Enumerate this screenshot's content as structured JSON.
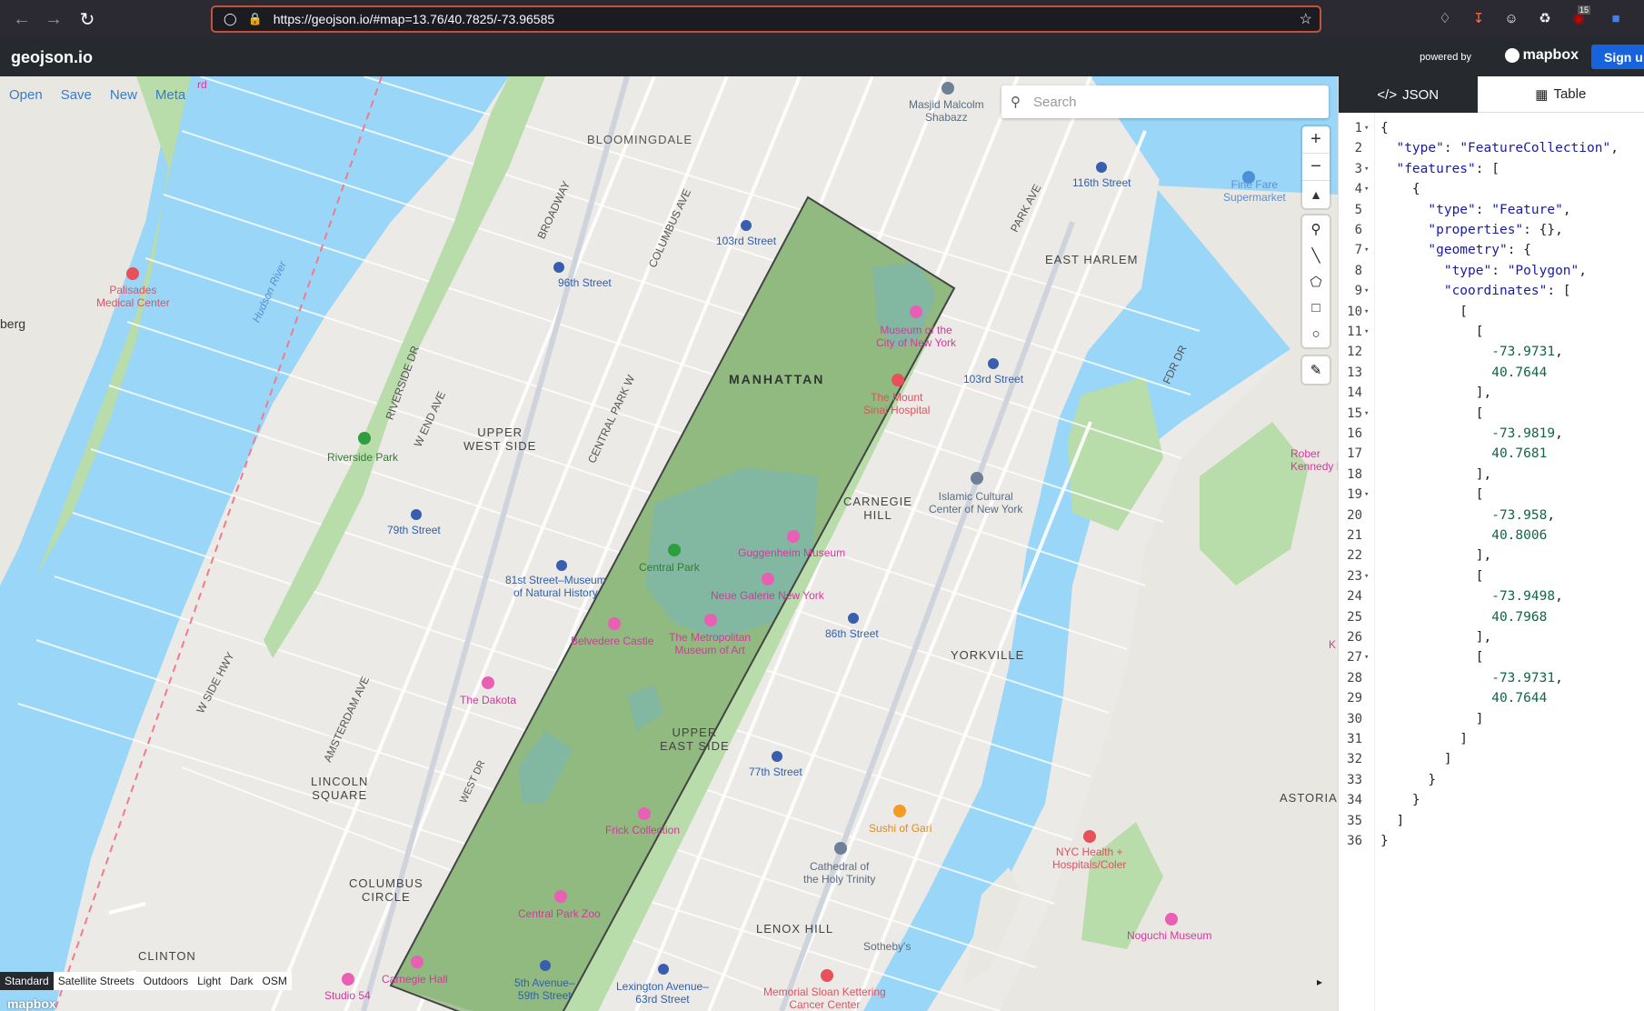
{
  "browser": {
    "url": "https://geojson.io/#map=13.76/40.7825/-73.96585",
    "badge_count": "15"
  },
  "header": {
    "logo": "geojson.io",
    "powered_by": "powered by",
    "mapbox": "mapbox",
    "signup": "Sign u"
  },
  "file_menu": {
    "open": "Open",
    "save": "Save",
    "new": "New",
    "meta": "Meta"
  },
  "search": {
    "placeholder": "Search"
  },
  "layers": {
    "standard": "Standard",
    "satellite": "Satellite Streets",
    "outdoors": "Outdoors",
    "light": "Light",
    "dark": "Dark",
    "osm": "OSM"
  },
  "map_watermark": "mapbox",
  "map_labels": {
    "bloomingdale": "BLOOMINGDALE",
    "manhattan": "MANHATTAN",
    "upper_west_side": "UPPER\nWEST SIDE",
    "east_harlem": "EAST HARLEM",
    "carnegie_hill": "CARNEGIE\nHILL",
    "yorkville": "YORKVILLE",
    "upper_east_side": "UPPER\nEAST SIDE",
    "lenox_hill": "LENOX HILL",
    "lincoln_square": "LINCOLN\nSQUARE",
    "columbus_circle": "COLUMBUS\nCIRCLE",
    "clinton": "CLINTON",
    "astoria": "ASTORIA",
    "central_park": "Central Park",
    "riverside_park": "Riverside Park",
    "palisades": "Palisades\nMedical Center",
    "museum_city": "Museum of the\nCity of New York",
    "mount_sinai": "The Mount\nSinai Hospital",
    "guggenheim": "Guggenheim Museum",
    "neue_galerie": "Neue Galerie New York",
    "met": "The Metropolitan\nMuseum of Art",
    "belvedere": "Belvedere Castle",
    "dakota": "The Dakota",
    "natural_history": "81st Street–Museum\nof Natural History",
    "frick": "Frick Collection",
    "zoo": "Central Park Zoo",
    "carnegie_hall": "Carnegie Hall",
    "studio54": "Studio 54",
    "islamic": "Islamic Cultural\nCenter of New York",
    "cathedral": "Cathedral of\nthe Holy Trinity",
    "sushi": "Sushi of Gari",
    "nyc_health": "NYC Health +\nHospitals/Coler",
    "noguchi": "Noguchi Museum",
    "sothebys": "Sotheby's",
    "memorial": "Memorial Sloan Kettering\nCancer Center",
    "fine_fare": "Fine Fare\nSupermarket",
    "masjid": "Masjid Malcolm\nShabazz",
    "st_103_w": "103rd Street",
    "st_96": "96th Street",
    "st_79": "79th Street",
    "st_116": "116th Street",
    "st_103_e": "103rd Street",
    "st_86": "86th Street",
    "st_77": "77th Street",
    "st_5th": "5th Avenue–\n59th Street",
    "st_lex": "Lexington Avenue–\n63rd Street",
    "hudson": "Hudson River",
    "broadway": "BROADWAY",
    "columbus_ave": "COLUMBUS AVE",
    "central_park_w": "CENTRAL PARK W",
    "amsterdam": "AMSTERDAM AVE",
    "w_end": "W END AVE",
    "riverside_dr": "RIVERSIDE DR",
    "park_ave": "PARK AVE",
    "fdr": "FDR DR",
    "west_side_hwy": "W SIDE HWY",
    "west_dr": "WEST DR",
    "berg": "berg",
    "rd": "rd",
    "robert_kennedy": "Rober\nKennedy B",
    "k_label": "K"
  },
  "panel": {
    "tab_json": "JSON",
    "tab_table": "Table"
  },
  "code_lines": [
    "{",
    "  \"type\": \"FeatureCollection\",",
    "  \"features\": [",
    "    {",
    "      \"type\": \"Feature\",",
    "      \"properties\": {},",
    "      \"geometry\": {",
    "        \"type\": \"Polygon\",",
    "        \"coordinates\": [",
    "          [",
    "            [",
    "              -73.9731,",
    "              40.7644",
    "            ],",
    "            [",
    "              -73.9819,",
    "              40.7681",
    "            ],",
    "            [",
    "              -73.958,",
    "              40.8006",
    "            ],",
    "            [",
    "              -73.9498,",
    "              40.7968",
    "            ],",
    "            [",
    "              -73.9731,",
    "              40.7644",
    "            ]",
    "          ]",
    "        ]",
    "      }",
    "    }",
    "  ]",
    "}"
  ],
  "colors": {
    "water": "#99d6f7",
    "park": "#b8dcaa",
    "polygon_fill": "#6f9e5c",
    "header_bg": "#262a2e",
    "link": "#3a7bc8"
  }
}
